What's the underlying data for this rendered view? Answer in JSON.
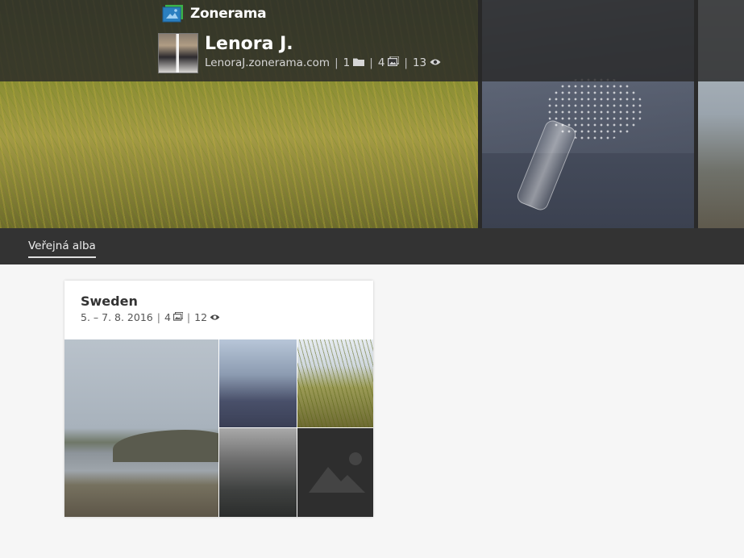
{
  "brand": {
    "name": "Zonerama"
  },
  "profile": {
    "name": "Lenora J.",
    "url": "LenoraJ.zonerama.com",
    "albums_count": "1",
    "photos_count": "4",
    "views_count": "13"
  },
  "tabs": [
    {
      "label": "Veřejná alba",
      "active": true
    }
  ],
  "albums": [
    {
      "title": "Sweden",
      "dates": "5. – 7. 8. 2016",
      "photos_count": "4",
      "views_count": "12"
    }
  ],
  "icons": {
    "logo": "zonerama-logo-icon",
    "folder": "folder-icon",
    "photos": "photos-icon",
    "views": "eye-icon",
    "placeholder": "image-placeholder-icon"
  },
  "colors": {
    "header_bg": "#333333",
    "page_bg": "#f6f6f6",
    "logo_blue": "#2a7fc0",
    "logo_green": "#3cb049"
  }
}
